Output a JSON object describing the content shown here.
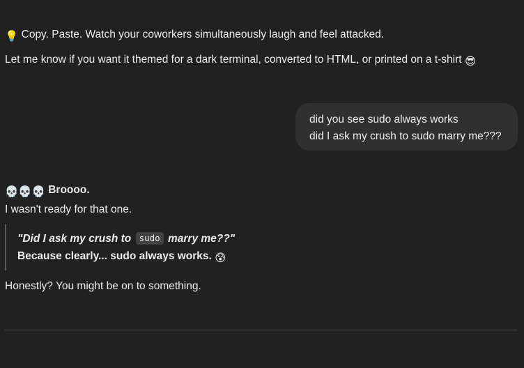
{
  "previous_message": {
    "tip_emoji": "💡",
    "tip_text": "Copy. Paste. Watch your coworkers simultaneously laugh and feel attacked.",
    "followup_text": "Let me know if you want it themed for a dark terminal, converted to HTML, or printed on a t-shirt",
    "followup_emoji": "😎"
  },
  "user_message": {
    "line1": "did you see sudo always works",
    "line2": "did I ask my crush to sudo marry me???"
  },
  "assistant_reply": {
    "heading_emojis": "💀💀💀",
    "heading_text": "Broooo.",
    "intro": "I wasn't ready for that one.",
    "quote": {
      "line1_prefix": "\"Did I ask my crush to",
      "line1_code": "sudo",
      "line1_suffix": "marry me??\"",
      "line2_text": "Because clearly... sudo always works.",
      "line2_emoji": "😰"
    },
    "closing": "Honestly? You might be on to something."
  },
  "colors": {
    "background": "#212121",
    "text": "#ececec",
    "user_bubble": "#303030",
    "code_chip": "#424242",
    "quote_border": "#5a5a5a"
  }
}
